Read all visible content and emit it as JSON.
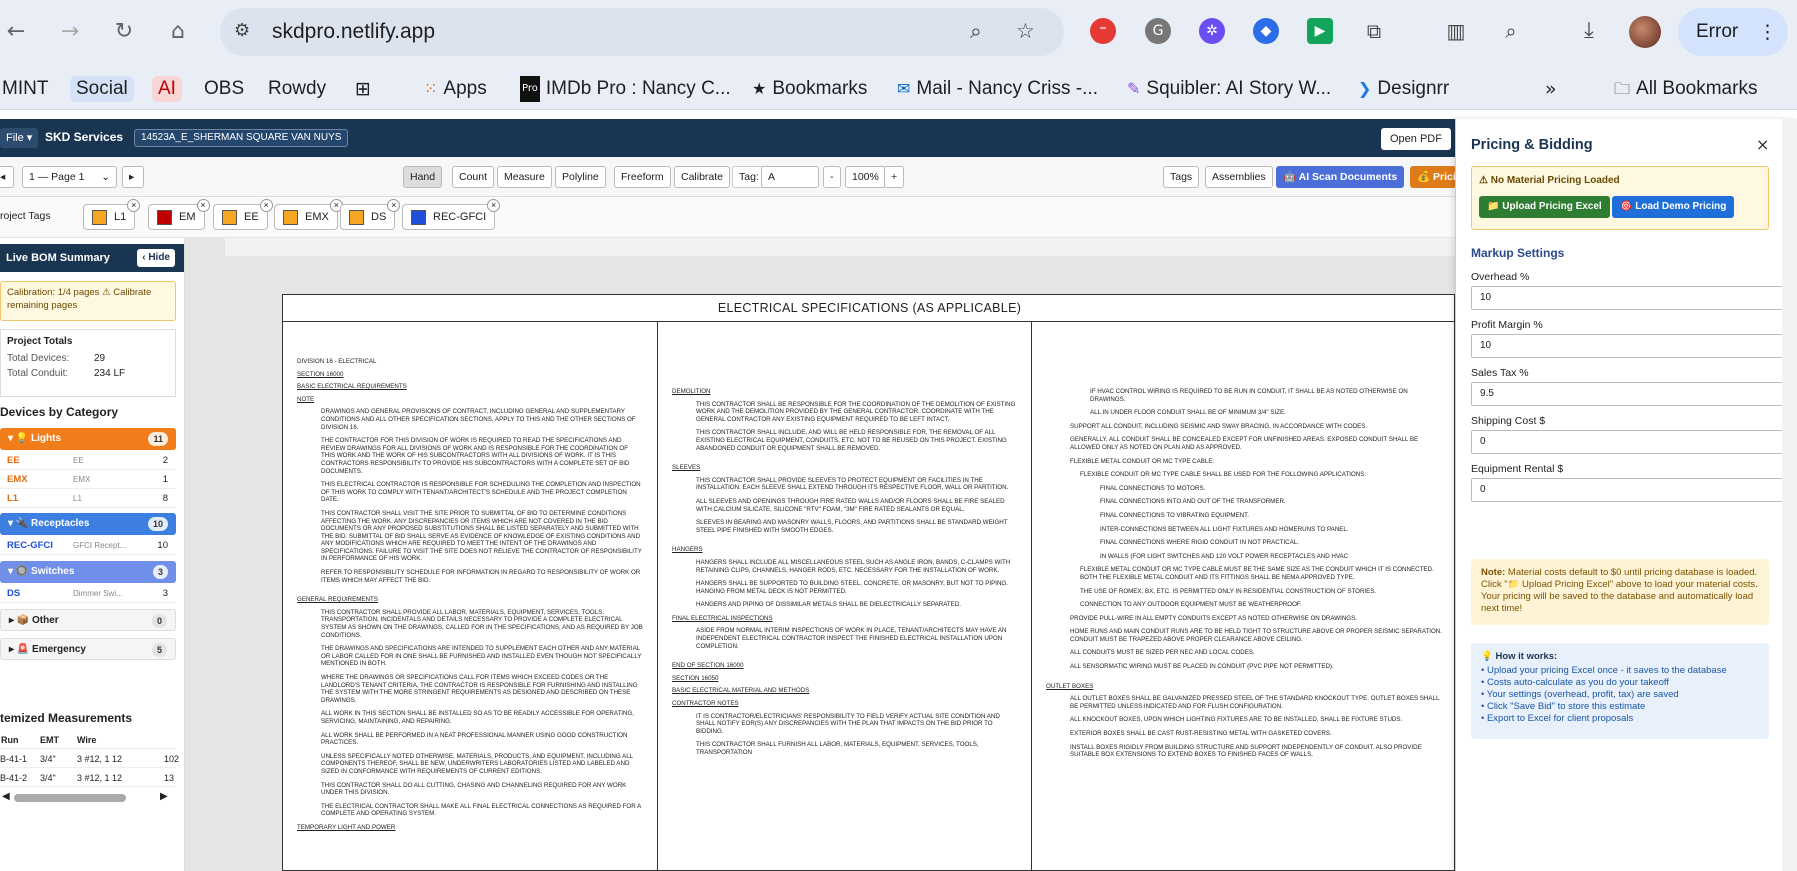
{
  "browser": {
    "url": "skdpro.netlify.app",
    "profile_label": "Error",
    "bookmarks": [
      {
        "label": "MINT"
      },
      {
        "label": "Social"
      },
      {
        "label": "AI"
      },
      {
        "label": "OBS"
      },
      {
        "label": "Rowdy"
      },
      {
        "label": "Apps"
      },
      {
        "label": "IMDb Pro : Nancy C..."
      },
      {
        "label": "Bookmarks"
      },
      {
        "label": "Mail - Nancy Criss -..."
      },
      {
        "label": "Squibler: AI Story W..."
      },
      {
        "label": "Designrr"
      },
      {
        "label": "All Bookmarks"
      }
    ]
  },
  "app": {
    "file_menu": "File ▾",
    "brand": "SKD Services",
    "project": "14523A_E_SHERMAN SQUARE VAN NUYS",
    "open_pdf": "Open PDF"
  },
  "toolbar": {
    "page": "1 — Page 1",
    "tools": [
      "Hand",
      "Count",
      "Measure",
      "Polyline",
      "Freeform",
      "Calibrate"
    ],
    "tag_label": "Tag:",
    "tag_value": "A",
    "zoom_minus": "-",
    "zoom": "100%",
    "zoom_plus": "+",
    "tags": "Tags",
    "assemblies": "Assemblies",
    "ai_scan": "AI Scan Documents",
    "pricing": "Prici"
  },
  "project_tags": {
    "label": "roject Tags",
    "tags": [
      {
        "label": "L1",
        "color": "#f5a623"
      },
      {
        "label": "EM",
        "color": "#c00000"
      },
      {
        "label": "EE",
        "color": "#f5a623"
      },
      {
        "label": "EMX",
        "color": "#f5a623"
      },
      {
        "label": "DS",
        "color": "#f5a623"
      },
      {
        "label": "REC-GFCI",
        "color": "#1f4fd8"
      }
    ]
  },
  "bom": {
    "title": "Live BOM Summary",
    "hide": "‹ Hide",
    "calibration": "Calibration: 1/4 pages ⚠ Calibrate remaining pages",
    "totals_title": "Project Totals",
    "total_devices_label": "Total Devices:",
    "total_devices": "29",
    "total_conduit_label": "Total Conduit:",
    "total_conduit": "234 LF",
    "category_title": "Devices by Category",
    "categories": [
      {
        "name": "Lights",
        "count": "11",
        "color": "#f07d1a"
      },
      {
        "name": "Receptacles",
        "count": "10",
        "color": "#3d7fe0"
      },
      {
        "name": "Switches",
        "count": "3",
        "color": "#6f8fe8"
      },
      {
        "name": "Other",
        "count": "0"
      },
      {
        "name": "Emergency",
        "count": "5"
      }
    ],
    "items": [
      {
        "code": "EE",
        "desc": "EE",
        "qty": "2",
        "color": "#e06a10"
      },
      {
        "code": "EMX",
        "desc": "EMX",
        "qty": "1",
        "color": "#e06a10"
      },
      {
        "code": "L1",
        "desc": "L1",
        "qty": "8",
        "color": "#e06a10"
      },
      {
        "code": "REC-GFCI",
        "desc": "GFCI Recept...",
        "qty": "10",
        "color": "#1f4fd8"
      },
      {
        "code": "DS",
        "desc": "Dimmer Swi...",
        "qty": "3",
        "color": "#1f4fd8"
      }
    ],
    "measurements_title": "temized Measurements",
    "meas_headers": [
      "Run",
      "EMT",
      "Wire"
    ],
    "measurements": [
      {
        "run": "B-41-1",
        "emt": "3/4\"",
        "wire": "3 #12, 1 12",
        "len": "102"
      },
      {
        "run": "B-41-2",
        "emt": "3/4\"",
        "wire": "3 #12, 1 12",
        "len": "13"
      }
    ]
  },
  "sheet": {
    "title": "ELECTRICAL SPECIFICATIONS (AS APPLICABLE)",
    "col1": {
      "division": "DIVISION 16 - ELECTRICAL",
      "section": "SECTION 16000",
      "heading": "BASIC ELECTRICAL REQUIREMENTS",
      "note": "NOTE",
      "p1": "DRAWINGS AND GENERAL PROVISIONS OF CONTRACT, INCLUDING GENERAL AND SUPPLEMENTARY CONDITIONS AND ALL OTHER SPECIFICATION SECTIONS, APPLY TO THIS AND THE OTHER SECTIONS OF DIVISION 16.",
      "p2": "THE CONTRACTOR FOR THIS DIVISION OF WORK IS REQUIRED TO READ THE SPECIFICATIONS AND REVIEW DRAWINGS FOR ALL DIVISIONS OF WORK AND IS RESPONSIBLE FOR THE COORDINATION OF THIS WORK AND THE WORK OF HIS SUBCONTRACTORS WITH ALL DIVISIONS OF WORK. IT IS THIS CONTRACTORS RESPONSIBILITY TO PROVIDE HIS SUBCONTRACTORS WITH A COMPLETE SET OF BID DOCUMENTS.",
      "p3": "THIS ELECTRICAL CONTRACTOR IS RESPONSIBLE FOR SCHEDULING THE COMPLETION AND INSPECTION OF THIS WORK TO COMPLY WITH TENANT/ARCHITECT'S SCHEDULE AND THE PROJECT COMPLETION DATE.",
      "p4": "THIS CONTRACTOR SHALL VISIT THE SITE PRIOR TO SUBMITTAL OF BID TO DETERMINE CONDITIONS AFFECTING THE WORK. ANY DISCREPANCIES OR ITEMS WHICH ARE NOT COVERED IN THE BID DOCUMENTS OR ANY PROPOSED SUBSTITUTIONS SHALL BE LISTED SEPARATELY AND SUBMITTED WITH THE BID. SUBMITTAL OF BID SHALL SERVE AS EVIDENCE OF KNOWLEDGE OF EXISTING CONDITIONS AND ANY MODIFICATIONS WHICH ARE REQUIRED TO MEET THE INTENT OF THE DRAWINGS AND SPECIFICATIONS. FAILURE TO VISIT THE SITE DOES NOT RELIEVE THE CONTRACTOR OF RESPONSIBILITY IN PERFORMANCE OF HIS WORK.",
      "p5": "REFER TO RESPONSIBILITY SCHEDULE FOR INFORMATION IN REGARD TO RESPONSIBILITY OF WORK OR ITEMS WHICH MAY AFFECT THE BID.",
      "gr": "GENERAL REQUIREMENTS",
      "g1": "THIS CONTRACTOR SHALL PROVIDE ALL LABOR, MATERIALS, EQUIPMENT, SERVICES, TOOLS, TRANSPORTATION, INCIDENTALS AND DETAILS NECESSARY TO PROVIDE A COMPLETE ELECTRICAL SYSTEM AS SHOWN ON THE DRAWINGS, CALLED FOR IN THE SPECIFICATIONS, AND AS REQUIRED BY JOB CONDITIONS.",
      "g2": "THE DRAWINGS AND SPECIFICATIONS ARE INTENDED TO SUPPLEMENT EACH OTHER AND ANY MATERIAL OR LABOR CALLED FOR IN ONE SHALL BE FURNISHED AND INSTALLED EVEN THOUGH NOT SPECIFICALLY MENTIONED IN BOTH.",
      "g3": "WHERE THE DRAWINGS OR SPECIFICATIONS CALL FOR ITEMS WHICH EXCEED CODES OR THE LANDLORD'S TENANT CRITERIA, THE CONTRACTOR IS RESPONSIBLE FOR FURNISHING AND INSTALLING THE SYSTEM WITH THE MORE STRINGENT REQUIREMENTS AS DESIGNED AND DESCRIBED ON THESE DRAWINGS.",
      "g4": "ALL WORK IN THIS SECTION SHALL BE INSTALLED SO AS TO BE READILY ACCESSIBLE FOR OPERATING, SERVICING, MAINTAINING, AND REPAIRING.",
      "g5": "ALL WORK SHALL BE PERFORMED IN A NEAT PROFESSIONAL MANNER USING GOOD CONSTRUCTION PRACTICES.",
      "g6": "UNLESS SPECIFICALLY NOTED OTHERWISE, MATERIALS, PRODUCTS, AND EQUIPMENT, INCLUDING ALL COMPONENTS THEREOF, SHALL BE NEW, UNDERWRITERS LABORATORIES LISTED AND LABELED AND SIZED IN CONFORMANCE WITH REQUIREMENTS OF CURRENT EDITIONS.",
      "g7": "THIS CONTRACTOR SHALL DO ALL CUTTING, CHASING AND CHANNELING REQUIRED FOR ANY WORK UNDER THIS DIVISION.",
      "g8": "THE ELECTRICAL CONTRACTOR SHALL MAKE ALL FINAL ELECTRICAL CONNECTIONS AS REQUIRED FOR A COMPLETE AND OPERATING SYSTEM.",
      "tlp": "TEMPORARY LIGHT AND POWER"
    },
    "col2": {
      "k": "DEMOLITION",
      "k1": "THIS CONTRACTOR SHALL BE RESPONSIBLE FOR THE COORDINATION OF THE DEMOLITION OF EXISTING WORK AND THE DEMOLITION PROVIDED BY THE GENERAL CONTRACTOR. COORDINATE WITH THE GENERAL CONTRACTOR ANY EXISTING EQUIPMENT REQUIRED TO BE LEFT INTACT.",
      "k2": "THIS CONTRACTOR SHALL INCLUDE, AND WILL BE HELD RESPONSIBLE FOR, THE REMOVAL OF ALL EXISTING ELECTRICAL EQUIPMENT, CONDUITS, ETC. NOT TO BE REUSED ON THIS PROJECT. EXISTING ABANDONED CONDUIT OR EQUIPMENT SHALL BE REMOVED.",
      "l": "SLEEVES",
      "l1": "THIS CONTRACTOR SHALL PROVIDE SLEEVES TO PROTECT EQUIPMENT OR FACILITIES IN THE INSTALLATION. EACH SLEEVE SHALL EXTEND THROUGH ITS RESPECTIVE FLOOR, WALL OR PARTITION.",
      "l2": "ALL SLEEVES AND OPENINGS THROUGH FIRE RATED WALLS AND/OR FLOORS SHALL BE FIRE SEALED WITH CALCIUM SILICATE, SILICONE \"RTV\" FOAM, \"3M\" FIRE RATED SEALANTS OR EQUAL.",
      "l3": "SLEEVES IN BEARING AND MASONRY WALLS, FLOORS, AND PARTITIONS SHALL BE STANDARD WEIGHT STEEL PIPE FINISHED WITH SMOOTH EDGES.",
      "m": "HANGERS",
      "m1": "HANGERS SHALL INCLUDE ALL MISCELLANEOUS STEEL SUCH AS ANGLE IRON, BANDS, C-CLAMPS WITH RETAINING CLIPS, CHANNELS, HANGER RODS, ETC. NECESSARY FOR THE INSTALLATION OF WORK.",
      "m2": "HANGERS SHALL BE SUPPORTED TO BUILDING STEEL, CONCRETE, OR MASONRY, BUT NOT TO PIPING. HANGING FROM METAL DECK IS NOT PERMITTED.",
      "m3": "HANGERS AND PIPING OF DISSIMILAR METALS SHALL BE DIELECTRICALLY SEPARATED.",
      "n": "FINAL ELECTRICAL INSPECTIONS",
      "n1": "ASIDE FROM NORMAL INTERIM INSPECTIONS OF WORK IN PLACE, TENANT/ARCHITECTS MAY HAVE AN INDEPENDENT ELECTRICAL CONTRACTOR INSPECT THE FINISHED ELECTRICAL INSTALLATION UPON COMPLETION.",
      "end": "END OF SECTION 16000",
      "sec": "SECTION 16050",
      "basic": "BASIC ELECTRICAL MATERIAL AND METHODS",
      "cn": "CONTRACTOR NOTES",
      "cn1": "IT IS CONTRACTOR/ELECTRICIANS' RESPONSIBILITY TO FIELD VERIFY ACTUAL SITE CONDITION AND SHALL NOTIFY EOR(S) ANY DISCREPANCIES WITH THE PLAN THAT IMPACTS ON THE BID PRIOR TO BIDDING.",
      "cn2": "THIS CONTRACTOR SHALL FURNISH ALL LABOR, MATERIALS, EQUIPMENT, SERVICES, TOOLS, TRANSPORTATION"
    },
    "col3": {
      "c": "IF HVAC CONTROL WIRING IS REQUIRED TO BE RUN IN CONDUIT, IT SHALL BE AS NOTED OTHERWISE ON DRAWINGS.",
      "d": "ALL IN UNDER FLOOR CONDUIT SHALL BE OF MINIMUM 3/4\" SIZE.",
      "s4": "SUPPORT ALL CONDUIT, INCLUDING SEISMIC AND SWAY BRACING, IN ACCORDANCE WITH CODES.",
      "s5": "GENERALLY, ALL CONDUIT SHALL BE CONCEALED EXCEPT FOR UNFINISHED AREAS. EXPOSED CONDUIT SHALL BE ALLOWED ONLY AS NOTED ON PLAN AND AS APPROVED.",
      "s6": "FLEXIBLE METAL CONDUIT OR MC TYPE CABLE:",
      "a": "FLEXIBLE CONDUIT OR MC TYPE CABLE SHALL BE USED FOR THE FOLLOWING APPLICATIONS:",
      "a1": "FINAL CONNECTIONS TO MOTORS.",
      "a2": "FINAL CONNECTIONS INTO AND OUT OF THE TRANSFORMER.",
      "a3": "FINAL CONNECTIONS TO VIBRATING EQUIPMENT.",
      "a4": "INTER-CONNECTIONS BETWEEN ALL LIGHT FIXTURES AND HOMERUNS TO PANEL.",
      "a5": "FINAL CONNECTIONS WHERE RIGID CONDUIT IN NOT PRACTICAL.",
      "a6": "IN WALLS (FOR LIGHT SWITCHES AND 120 VOLT POWER RECEPTACLES AND HVAC",
      "b": "FLEXIBLE METAL CONDUIT OR MC TYPE CABLE MUST BE THE SAME SIZE AS THE CONDUIT WHICH IT IS CONNECTED. BOTH THE FLEXIBLE METAL CONDUIT AND ITS FITTINGS SHALL BE NEMA APPROVED TYPE.",
      "cc": "THE USE OF ROMEX, BX, ETC. IS PERMITTED ONLY IN RESIDENTIAL CONSTRUCTION OF STORIES.",
      "dd": "CONNECTION TO ANY OUTDOOR EQUIPMENT MUST BE WEATHERPROOF.",
      "s7": "PROVIDE PULL-WIRE IN ALL EMPTY CONDUITS EXCEPT AS NOTED OTHERWISE ON DRAWINGS.",
      "s8": "HOME RUNS AND MAIN CONDUIT RUNS ARE TO BE HELD TIGHT TO STRUCTURE ABOVE OR PROPER SEISMIC SEPARATION. CONDUIT MUST BE TRAPEZED ABOVE PROPER CLEARANCE ABOVE CEILING.",
      "s9": "ALL CONDUITS MUST BE SIZED PER NEC AND LOCAL CODES.",
      "s10": "ALL SENSORMATIC WIRING MUST BE PLACED IN CONDUIT (PVC PIPE NOT PERMITTED).",
      "ob": "OUTLET BOXES",
      "o1": "ALL OUTLET BOXES SHALL BE GALVANIZED PRESSED STEEL OF THE STANDARD KNOCKOUT TYPE. OUTLET BOXES SHALL BE PERMITTED UNLESS INDICATED AND FOR FLUSH CONFIGURATION.",
      "o2": "ALL KNOCKOUT BOXES, UPON WHICH LIGHTING FIXTURES ARE TO BE INSTALLED, SHALL BE FIXTURE STUDS.",
      "o3": "EXTERIOR BOXES SHALL BE CAST RUST-RESISTING METAL WITH GASKETED COVERS.",
      "o4": "INSTALL BOXES RIGIDLY FROM BUILDING STRUCTURE AND SUPPORT INDEPENDENTLY OF CONDUIT. ALSO PROVIDE SUITABLE BOX EXTENSIONS TO EXTEND BOXES TO FINISHED FACES OF WALLS."
    }
  },
  "pricing": {
    "title": "Pricing & Bidding",
    "close": "×",
    "no_material": "⚠ No Material Pricing Loaded",
    "upload": "Upload Pricing Excel",
    "demo": "Load Demo Pricing",
    "markup_title": "Markup Settings",
    "fields": [
      {
        "label": "Overhead %",
        "value": "10"
      },
      {
        "label": "Profit Margin %",
        "value": "10"
      },
      {
        "label": "Sales Tax %",
        "value": "9.5"
      },
      {
        "label": "Shipping Cost $",
        "value": "0"
      },
      {
        "label": "Equipment Rental $",
        "value": "0"
      }
    ],
    "note_label": "Note:",
    "note_text": "Material costs default to $0 until pricing database is loaded. Click \"📁 Upload Pricing Excel\" above to load your material costs. Your pricing will be saved to the database and automatically load next time!",
    "howto_title": "💡 How it works:",
    "howto_items": [
      "• Upload your pricing Excel once - it saves to the database",
      "• Costs auto-calculate as you do your takeoff",
      "• Your settings (overhead, profit, tax) are saved",
      "• Click \"Save Bid\" to store this estimate",
      "• Export to Excel for client proposals"
    ]
  }
}
